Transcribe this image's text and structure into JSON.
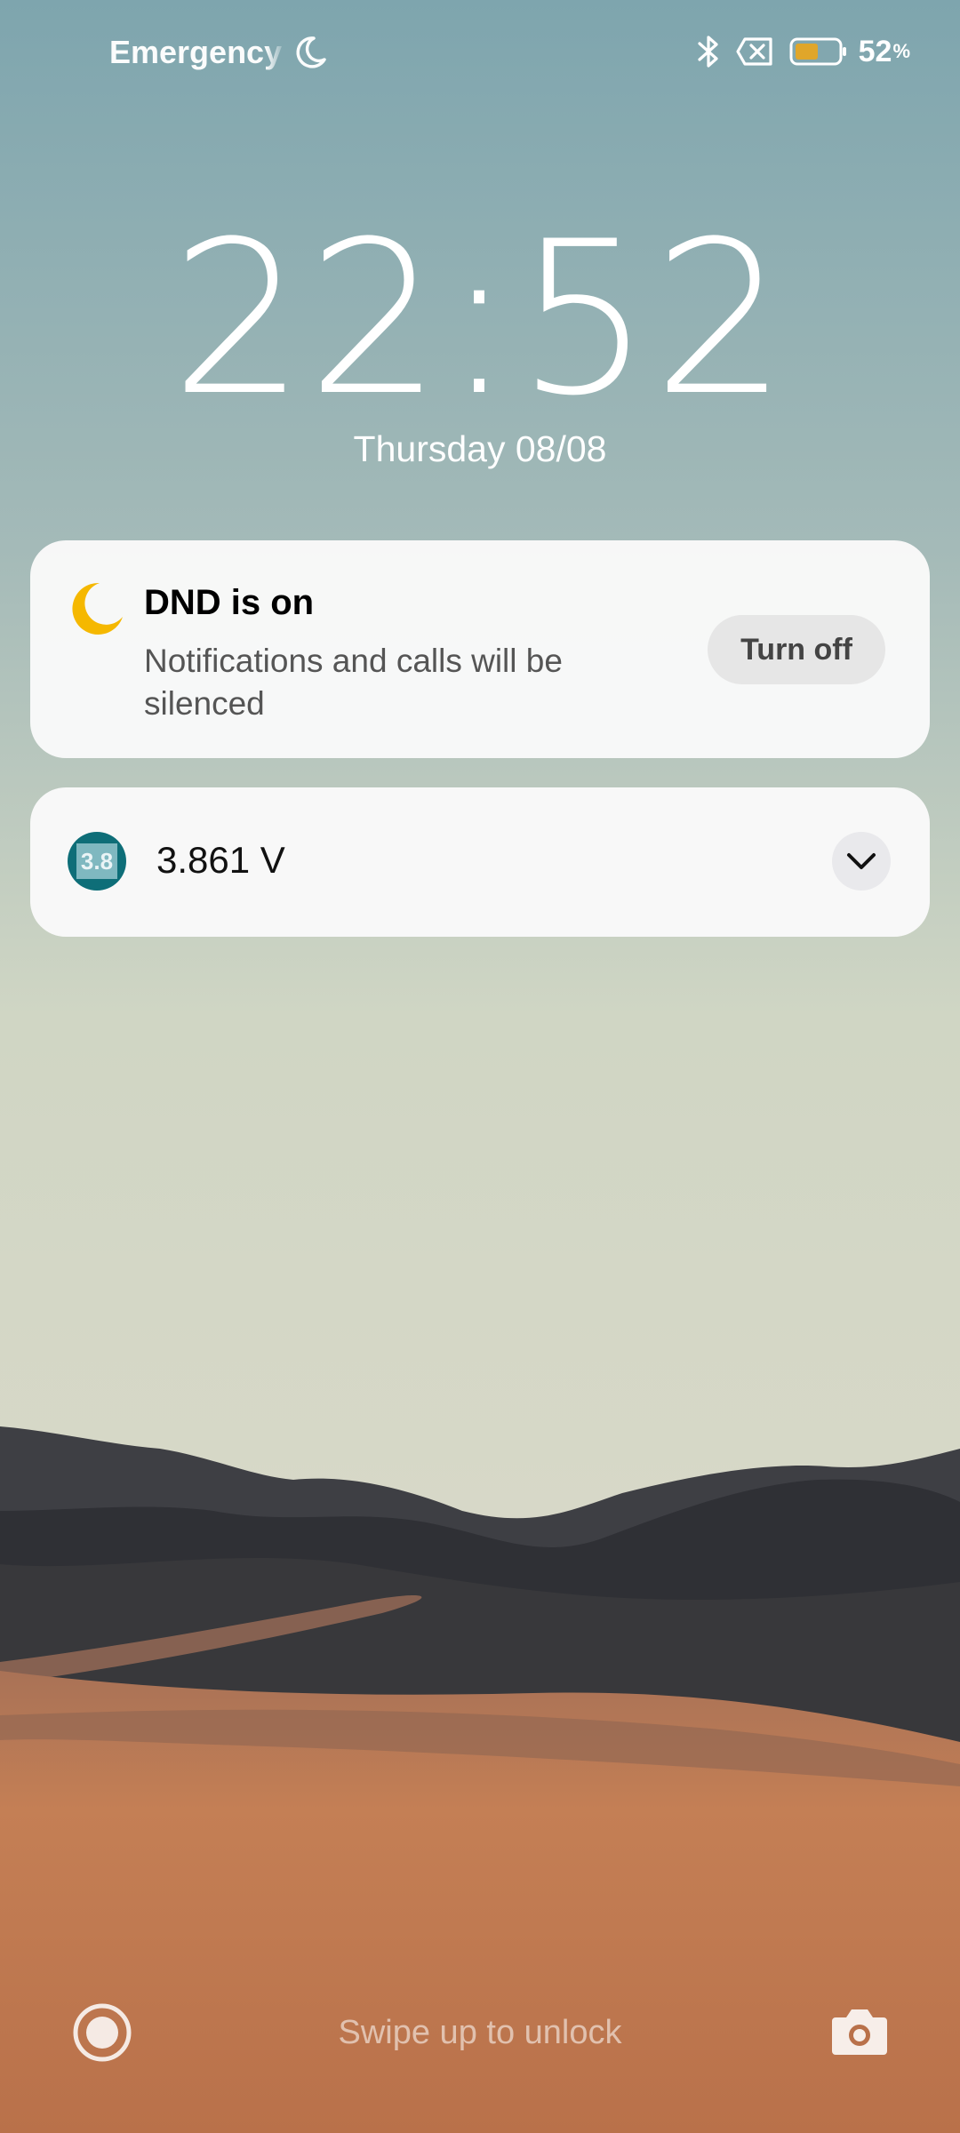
{
  "status_bar": {
    "carrier": "Emergency calls only",
    "battery_percent": "52",
    "battery_percent_sign": "%",
    "battery_level": 0.52,
    "icons": [
      "dnd-moon-icon",
      "bluetooth-icon",
      "no-sim-icon",
      "battery-icon"
    ]
  },
  "lockscreen": {
    "time": "22:52",
    "date": "Thursday 08/08",
    "unlock_hint": "Swipe up to unlock"
  },
  "notifications": [
    {
      "title": "DND is on",
      "body": "Notifications and calls will be silenced",
      "action_label": "Turn off",
      "icon": "moon-icon"
    },
    {
      "app_icon_text": "3.8",
      "text": "3.861 V",
      "icon": "voltage-app-icon"
    }
  ],
  "shortcuts": {
    "left": "assistant-icon",
    "right": "camera-icon"
  },
  "colors": {
    "sky_top": "#7fa5ad",
    "sky_bottom": "#d3d8c6",
    "sand": "#c47f55",
    "dnd_moon": "#f5b800",
    "app_icon": "#0e6e78",
    "battery_fill": "#e0a62a"
  }
}
